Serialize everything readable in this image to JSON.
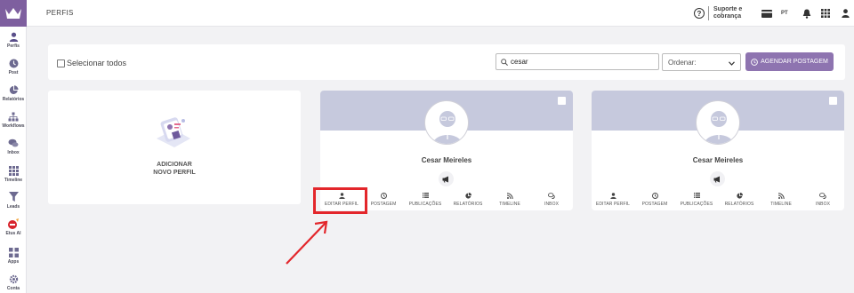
{
  "sidebar": {
    "items": [
      {
        "label": "Perfis",
        "icon": "user-icon"
      },
      {
        "label": "Post",
        "icon": "clock-icon"
      },
      {
        "label": "Relatórios",
        "icon": "pie-chart-icon"
      },
      {
        "label": "Workflows",
        "icon": "workflow-icon"
      },
      {
        "label": "Inbox",
        "icon": "chat-icon"
      },
      {
        "label": "Timeline",
        "icon": "grid-icon"
      },
      {
        "label": "Leads",
        "icon": "filter-icon"
      },
      {
        "label": "Etus AI",
        "icon": "ai-icon"
      },
      {
        "label": "Apps",
        "icon": "apps-icon"
      },
      {
        "label": "Conta",
        "icon": "gear-icon"
      }
    ]
  },
  "topbar": {
    "title": "PERFIS",
    "help": "?",
    "support_line1": "Suporte e",
    "support_line2": "cobrança",
    "lang": "PT"
  },
  "toolbar": {
    "select_all": "Selecionar todos",
    "search_value": "cesar",
    "order_value": "Ordenar:",
    "schedule_button": "AGENDAR POSTAGEM"
  },
  "add_profile": {
    "line1": "ADICIONAR",
    "line2": "NOVO PERFIL"
  },
  "profiles": [
    {
      "name": "Cesar Meireles"
    },
    {
      "name": "Cesar Meireles"
    }
  ],
  "actions": [
    "EDITAR PERFIL",
    "POSTAGEM",
    "PUBLICAÇÕES",
    "RELATÓRIOS",
    "TIMELINE",
    "INBOX"
  ],
  "colors": {
    "brand": "#7e5f9f",
    "button": "#8e74b0",
    "banner": "#c6c9dd",
    "highlight": "#e3262b"
  }
}
